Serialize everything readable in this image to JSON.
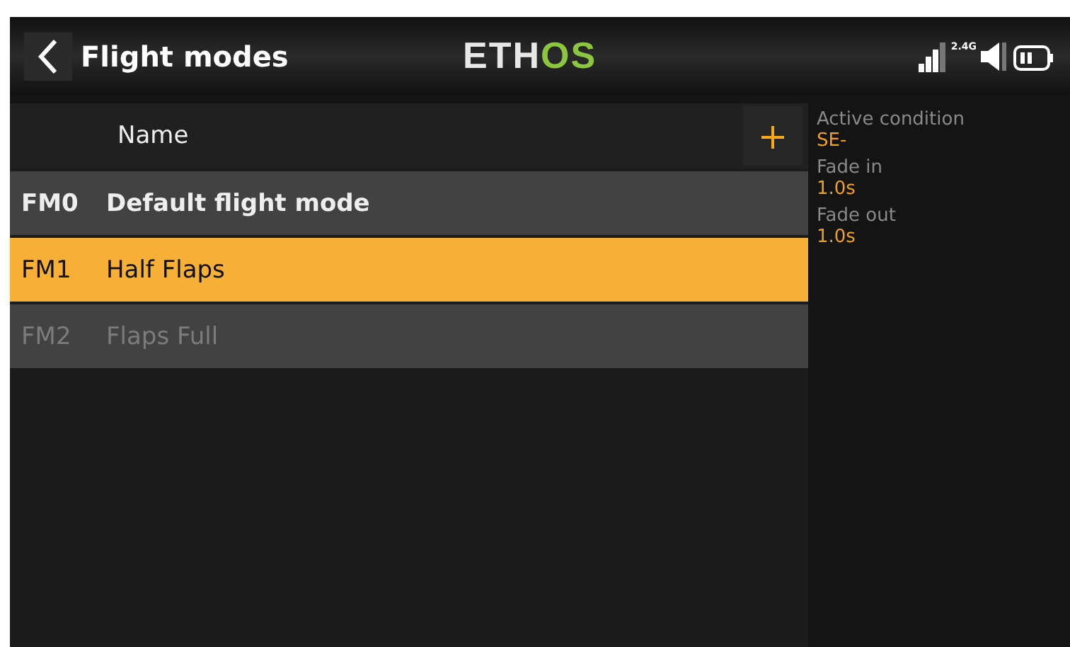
{
  "header": {
    "title": "Flight modes",
    "logo": {
      "text": "ETH",
      "accent": "OS"
    },
    "radio_band": "2.4G"
  },
  "table": {
    "columns": [
      "Name"
    ],
    "rows": [
      {
        "id": "FM0",
        "name": "Default flight mode",
        "active": true,
        "selected": false,
        "enabled": true
      },
      {
        "id": "FM1",
        "name": "Half Flaps",
        "active": false,
        "selected": true,
        "enabled": true
      },
      {
        "id": "FM2",
        "name": "Flaps Full",
        "active": false,
        "selected": false,
        "enabled": false
      }
    ]
  },
  "details": [
    {
      "label": "Active condition",
      "value": "SE-"
    },
    {
      "label": "Fade in",
      "value": "1.0s"
    },
    {
      "label": "Fade out",
      "value": "1.0s"
    }
  ]
}
